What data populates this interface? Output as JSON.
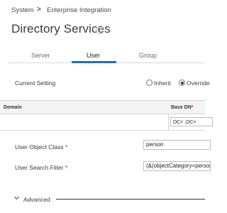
{
  "breadcrumb": {
    "items": [
      "System",
      "Enterprise Integration"
    ],
    "separator": ">"
  },
  "page": {
    "title": "Directory Services",
    "help_icon": "?"
  },
  "tabs": [
    {
      "label": "Server",
      "active": false
    },
    {
      "label": "User",
      "active": true
    },
    {
      "label": "Group",
      "active": false
    }
  ],
  "current_setting": {
    "label": "Current Setting",
    "options": [
      {
        "label": "Inherit",
        "selected": false
      },
      {
        "label": "Override",
        "selected": true
      }
    ]
  },
  "table": {
    "columns": [
      "Domain",
      "Base DN"
    ],
    "required_marker": "*",
    "rows": [
      {
        "domain": "",
        "base_dn": "DC=       ,DC="
      }
    ]
  },
  "fields": {
    "user_object_class": {
      "label": "User Object Class",
      "value": "person"
    },
    "user_search_filter": {
      "label": "User Search Filter",
      "value": "(&(objectCategory=person"
    }
  },
  "advanced": {
    "label": "Advanced"
  },
  "colors": {
    "accent": "#1f6fb5",
    "required": "#d21e1e"
  }
}
